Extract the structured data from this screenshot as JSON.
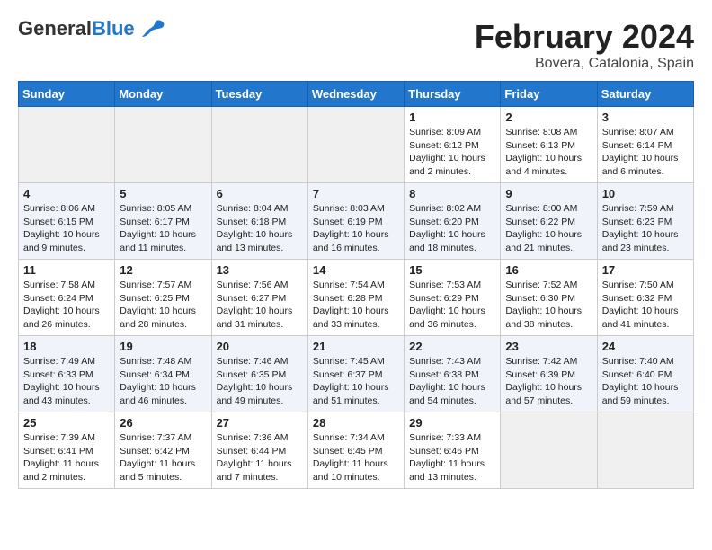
{
  "logo": {
    "line1": "General",
    "line2": "Blue"
  },
  "title": "February 2024",
  "location": "Bovera, Catalonia, Spain",
  "days_of_week": [
    "Sunday",
    "Monday",
    "Tuesday",
    "Wednesday",
    "Thursday",
    "Friday",
    "Saturday"
  ],
  "weeks": [
    [
      {
        "num": "",
        "info": ""
      },
      {
        "num": "",
        "info": ""
      },
      {
        "num": "",
        "info": ""
      },
      {
        "num": "",
        "info": ""
      },
      {
        "num": "1",
        "info": "Sunrise: 8:09 AM\nSunset: 6:12 PM\nDaylight: 10 hours\nand 2 minutes."
      },
      {
        "num": "2",
        "info": "Sunrise: 8:08 AM\nSunset: 6:13 PM\nDaylight: 10 hours\nand 4 minutes."
      },
      {
        "num": "3",
        "info": "Sunrise: 8:07 AM\nSunset: 6:14 PM\nDaylight: 10 hours\nand 6 minutes."
      }
    ],
    [
      {
        "num": "4",
        "info": "Sunrise: 8:06 AM\nSunset: 6:15 PM\nDaylight: 10 hours\nand 9 minutes."
      },
      {
        "num": "5",
        "info": "Sunrise: 8:05 AM\nSunset: 6:17 PM\nDaylight: 10 hours\nand 11 minutes."
      },
      {
        "num": "6",
        "info": "Sunrise: 8:04 AM\nSunset: 6:18 PM\nDaylight: 10 hours\nand 13 minutes."
      },
      {
        "num": "7",
        "info": "Sunrise: 8:03 AM\nSunset: 6:19 PM\nDaylight: 10 hours\nand 16 minutes."
      },
      {
        "num": "8",
        "info": "Sunrise: 8:02 AM\nSunset: 6:20 PM\nDaylight: 10 hours\nand 18 minutes."
      },
      {
        "num": "9",
        "info": "Sunrise: 8:00 AM\nSunset: 6:22 PM\nDaylight: 10 hours\nand 21 minutes."
      },
      {
        "num": "10",
        "info": "Sunrise: 7:59 AM\nSunset: 6:23 PM\nDaylight: 10 hours\nand 23 minutes."
      }
    ],
    [
      {
        "num": "11",
        "info": "Sunrise: 7:58 AM\nSunset: 6:24 PM\nDaylight: 10 hours\nand 26 minutes."
      },
      {
        "num": "12",
        "info": "Sunrise: 7:57 AM\nSunset: 6:25 PM\nDaylight: 10 hours\nand 28 minutes."
      },
      {
        "num": "13",
        "info": "Sunrise: 7:56 AM\nSunset: 6:27 PM\nDaylight: 10 hours\nand 31 minutes."
      },
      {
        "num": "14",
        "info": "Sunrise: 7:54 AM\nSunset: 6:28 PM\nDaylight: 10 hours\nand 33 minutes."
      },
      {
        "num": "15",
        "info": "Sunrise: 7:53 AM\nSunset: 6:29 PM\nDaylight: 10 hours\nand 36 minutes."
      },
      {
        "num": "16",
        "info": "Sunrise: 7:52 AM\nSunset: 6:30 PM\nDaylight: 10 hours\nand 38 minutes."
      },
      {
        "num": "17",
        "info": "Sunrise: 7:50 AM\nSunset: 6:32 PM\nDaylight: 10 hours\nand 41 minutes."
      }
    ],
    [
      {
        "num": "18",
        "info": "Sunrise: 7:49 AM\nSunset: 6:33 PM\nDaylight: 10 hours\nand 43 minutes."
      },
      {
        "num": "19",
        "info": "Sunrise: 7:48 AM\nSunset: 6:34 PM\nDaylight: 10 hours\nand 46 minutes."
      },
      {
        "num": "20",
        "info": "Sunrise: 7:46 AM\nSunset: 6:35 PM\nDaylight: 10 hours\nand 49 minutes."
      },
      {
        "num": "21",
        "info": "Sunrise: 7:45 AM\nSunset: 6:37 PM\nDaylight: 10 hours\nand 51 minutes."
      },
      {
        "num": "22",
        "info": "Sunrise: 7:43 AM\nSunset: 6:38 PM\nDaylight: 10 hours\nand 54 minutes."
      },
      {
        "num": "23",
        "info": "Sunrise: 7:42 AM\nSunset: 6:39 PM\nDaylight: 10 hours\nand 57 minutes."
      },
      {
        "num": "24",
        "info": "Sunrise: 7:40 AM\nSunset: 6:40 PM\nDaylight: 10 hours\nand 59 minutes."
      }
    ],
    [
      {
        "num": "25",
        "info": "Sunrise: 7:39 AM\nSunset: 6:41 PM\nDaylight: 11 hours\nand 2 minutes."
      },
      {
        "num": "26",
        "info": "Sunrise: 7:37 AM\nSunset: 6:42 PM\nDaylight: 11 hours\nand 5 minutes."
      },
      {
        "num": "27",
        "info": "Sunrise: 7:36 AM\nSunset: 6:44 PM\nDaylight: 11 hours\nand 7 minutes."
      },
      {
        "num": "28",
        "info": "Sunrise: 7:34 AM\nSunset: 6:45 PM\nDaylight: 11 hours\nand 10 minutes."
      },
      {
        "num": "29",
        "info": "Sunrise: 7:33 AM\nSunset: 6:46 PM\nDaylight: 11 hours\nand 13 minutes."
      },
      {
        "num": "",
        "info": ""
      },
      {
        "num": "",
        "info": ""
      }
    ]
  ]
}
